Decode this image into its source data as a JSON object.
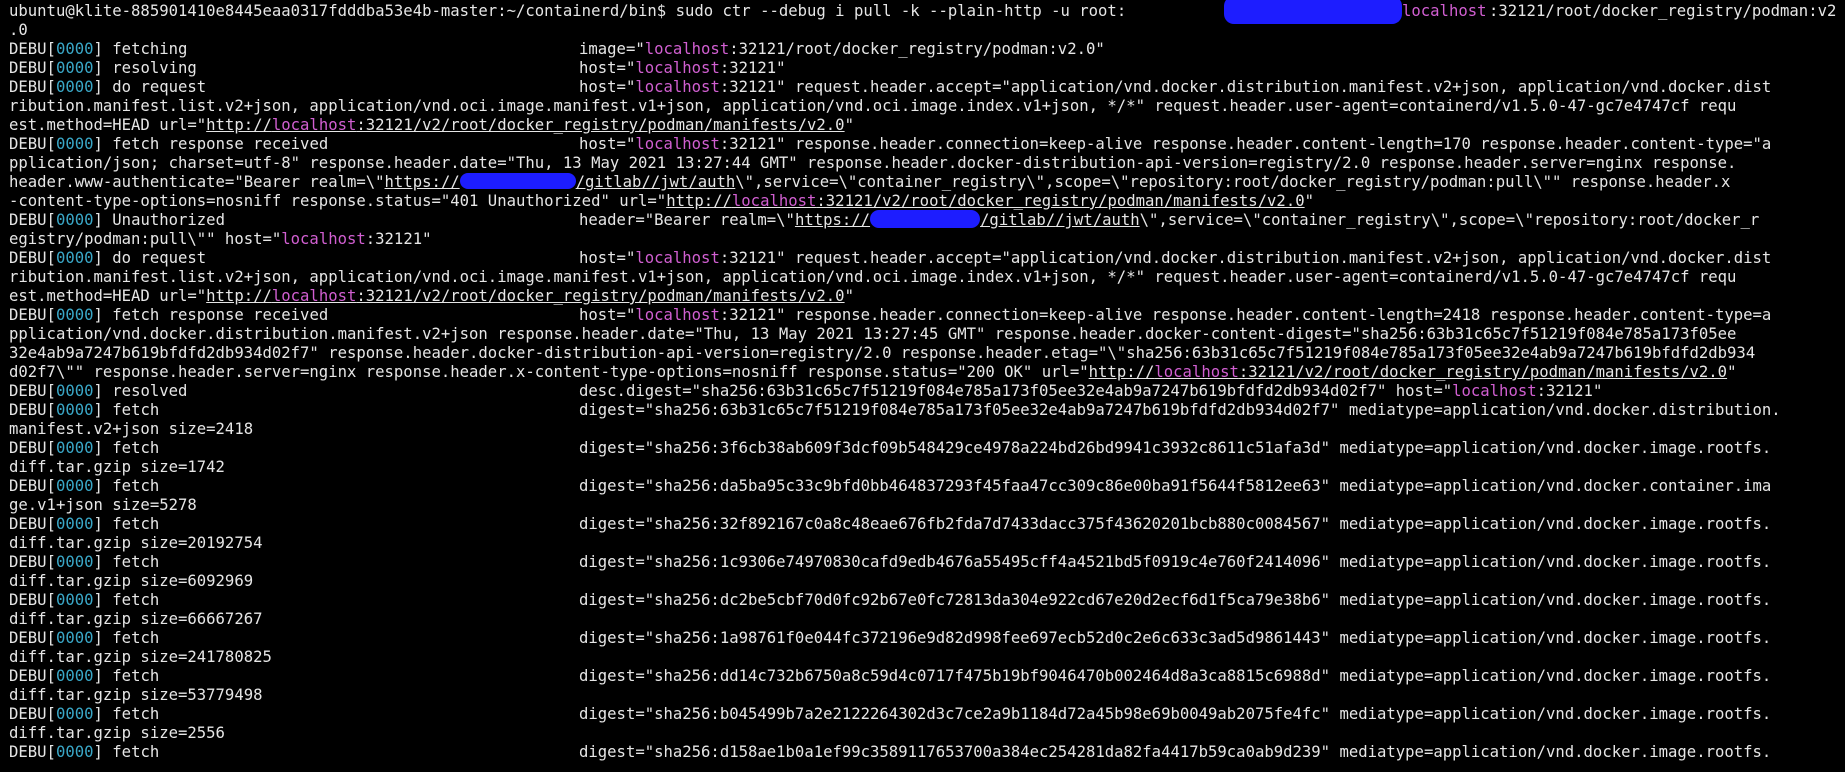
{
  "terminal": {
    "colors": {
      "background": "#000000",
      "text": "#e6e6e6",
      "debug_code": "#3aa8c8",
      "host": "#d15fd1",
      "redaction": "#1d1dff"
    },
    "prompt": {
      "user_host_path": "ubuntu@klite-885901410e8445eaa0317fdddba53e4b-master:~/containerd/bin$",
      "command": " sudo ctr --debug i pull -k --plain-http -u root:",
      "after_redaction_host": "localhost",
      "after_redaction_rest": ":32121/root/docker_registry/podman:v2",
      "wrap": ".0"
    },
    "debug_tag": {
      "prefix": "DEBU[",
      "code": "0000",
      "suffix": "]"
    },
    "lines": {
      "l1": {
        "msg": " fetching",
        "a": "image=\"",
        "host": "localhost",
        "b": ":32121/root/docker_registry/podman:v2.0\""
      },
      "l2": {
        "msg": " resolving",
        "a": "host=\"",
        "host": "localhost",
        "b": ":32121\""
      },
      "l3": {
        "msg": " do request",
        "a": "host=\"",
        "host": "localhost",
        "b": ":32121\" request.header.accept=\"application/vnd.docker.distribution.manifest.v2+json, application/vnd.docker.dist"
      },
      "l3w1": "ribution.manifest.list.v2+json, application/vnd.oci.image.manifest.v1+json, application/vnd.oci.image.index.v1+json, */*\" request.header.user-agent=containerd/v1.5.0-47-gc7e4747cf requ",
      "l3w2": {
        "a": "est.method=HEAD url=\"",
        "url_a": "http://",
        "url_host": "localhost",
        "url_b": ":32121/v2/root/docker_registry/podman/manifests/v2.0",
        "b": "\""
      },
      "l4": {
        "msg": " fetch response received",
        "a": "host=\"",
        "host": "localhost",
        "b": ":32121\" response.header.connection=keep-alive response.header.content-length=170 response.header.content-type=\"a"
      },
      "l4w1": "pplication/json; charset=utf-8\" response.header.date=\"Thu, 13 May 2021 13:27:44 GMT\" response.header.docker-distribution-api-version=registry/2.0 response.header.server=nginx response.",
      "l4w2": {
        "a": "header.www-authenticate=\"Bearer realm=\\\"",
        "url_a": "https://",
        "url_mid": "/gitlab/",
        "url_b": "/jwt/auth",
        "b": "\\\",service=\\\"container_registry\\\",scope=\\\"repository:root/docker_registry/podman:pull\\\"\" response.header.x"
      },
      "l4w3": {
        "a": "-content-type-options=nosniff response.status=\"401 Unauthorized\" url=\"",
        "url_a": "http://",
        "url_host": "localhost",
        "url_b": ":32121/v2/root/docker_registry/podman/manifests/v2.0",
        "b": "\""
      },
      "l5": {
        "msg": " Unauthorized",
        "a": "header=\"Bearer realm=\\\"",
        "url_a": "https://",
        "url_mid": "/gitlab/",
        "url_b": "/jwt/auth",
        "b": "\\\",service=\\\"container_registry\\\",scope=\\\"repository:root/docker_r"
      },
      "l5w1": {
        "a": "egistry/podman:pull\\\"\" host=\"",
        "host": "localhost",
        "b": ":32121\""
      },
      "l6": {
        "msg": " do request",
        "a": "host=\"",
        "host": "localhost",
        "b": ":32121\" request.header.accept=\"application/vnd.docker.distribution.manifest.v2+json, application/vnd.docker.dist"
      },
      "l6w1": "ribution.manifest.list.v2+json, application/vnd.oci.image.manifest.v1+json, application/vnd.oci.image.index.v1+json, */*\" request.header.user-agent=containerd/v1.5.0-47-gc7e4747cf requ",
      "l6w2": {
        "a": "est.method=HEAD url=\"",
        "url_a": "http://",
        "url_host": "localhost",
        "url_b": ":32121/v2/root/docker_registry/podman/manifests/v2.0",
        "b": "\""
      },
      "l7": {
        "msg": " fetch response received",
        "a": "host=\"",
        "host": "localhost",
        "b": ":32121\" response.header.connection=keep-alive response.header.content-length=2418 response.header.content-type=a"
      },
      "l7w1": "pplication/vnd.docker.distribution.manifest.v2+json response.header.date=\"Thu, 13 May 2021 13:27:45 GMT\" response.header.docker-content-digest=\"sha256:63b31c65c7f51219f084e785a173f05ee",
      "l7w2": "32e4ab9a7247b619bfdfd2db934d02f7\" response.header.docker-distribution-api-version=registry/2.0 response.header.etag=\"\\\"sha256:63b31c65c7f51219f084e785a173f05ee32e4ab9a7247b619bfdfd2db934",
      "l7w3": {
        "a": "d02f7\\\"\" response.header.server=nginx response.header.x-content-type-options=nosniff response.status=\"200 OK\" url=\"",
        "url_a": "http://",
        "url_host": "localhost",
        "url_b": ":32121/v2/root/docker_registry/podman/manifests/v2.0",
        "b": "\""
      },
      "l8": {
        "msg": " resolved",
        "a": "desc.digest=\"sha256:63b31c65c7f51219f084e785a173f05ee32e4ab9a7247b619bfdfd2db934d02f7\" host=\"",
        "host": "localhost",
        "b": ":32121\""
      }
    },
    "fetches": [
      {
        "msg": " fetch",
        "digest": "digest=\"sha256:63b31c65c7f51219f084e785a173f05ee32e4ab9a7247b619bfdfd2db934d02f7\" mediatype=application/vnd.docker.distribution.",
        "wrap": "manifest.v2+json size=2418"
      },
      {
        "msg": " fetch",
        "digest": "digest=\"sha256:3f6cb38ab609f3dcf09b548429ce4978a224bd26bd9941c3932c8611c51afa3d\" mediatype=application/vnd.docker.image.rootfs.",
        "wrap": "diff.tar.gzip size=1742"
      },
      {
        "msg": " fetch",
        "digest": "digest=\"sha256:da5ba95c33c9bfd0bb464837293f45faa47cc309c86e00ba91f5644f5812ee63\" mediatype=application/vnd.docker.container.ima",
        "wrap": "ge.v1+json size=5278"
      },
      {
        "msg": " fetch",
        "digest": "digest=\"sha256:32f892167c0a8c48eae676fb2fda7d7433dacc375f43620201bcb880c0084567\" mediatype=application/vnd.docker.image.rootfs.",
        "wrap": "diff.tar.gzip size=20192754"
      },
      {
        "msg": " fetch",
        "digest": "digest=\"sha256:1c9306e74970830cafd9edb4676a55495cff4a4521bd5f0919c4e760f2414096\" mediatype=application/vnd.docker.image.rootfs.",
        "wrap": "diff.tar.gzip size=6092969"
      },
      {
        "msg": " fetch",
        "digest": "digest=\"sha256:dc2be5cbf70d0fc92b67e0fc72813da304e922cd67e20d2ecf6d1f5ca79e38b6\" mediatype=application/vnd.docker.image.rootfs.",
        "wrap": "diff.tar.gzip size=66667267"
      },
      {
        "msg": " fetch",
        "digest": "digest=\"sha256:1a98761f0e044fc372196e9d82d998fee697ecb52d0c2e6c633c3ad5d9861443\" mediatype=application/vnd.docker.image.rootfs.",
        "wrap": "diff.tar.gzip size=241780825"
      },
      {
        "msg": " fetch",
        "digest": "digest=\"sha256:dd14c732b6750a8c59d4c0717f475b19bf9046470b002464d8a3ca8815c6988d\" mediatype=application/vnd.docker.image.rootfs.",
        "wrap": "diff.tar.gzip size=53779498"
      },
      {
        "msg": " fetch",
        "digest": "digest=\"sha256:b045499b7a2e2122264302d3c7ce2a9b1184d72a45b98e69b0049ab2075fe4fc\" mediatype=application/vnd.docker.image.rootfs.",
        "wrap": "diff.tar.gzip size=2556"
      },
      {
        "msg": " fetch",
        "digest": "digest=\"sha256:d158ae1b0a1ef99c3589117653700a384ec254281da82fa4417b59ca0ab9d239\" mediatype=application/vnd.docker.image.rootfs.",
        "wrap": ""
      }
    ]
  }
}
